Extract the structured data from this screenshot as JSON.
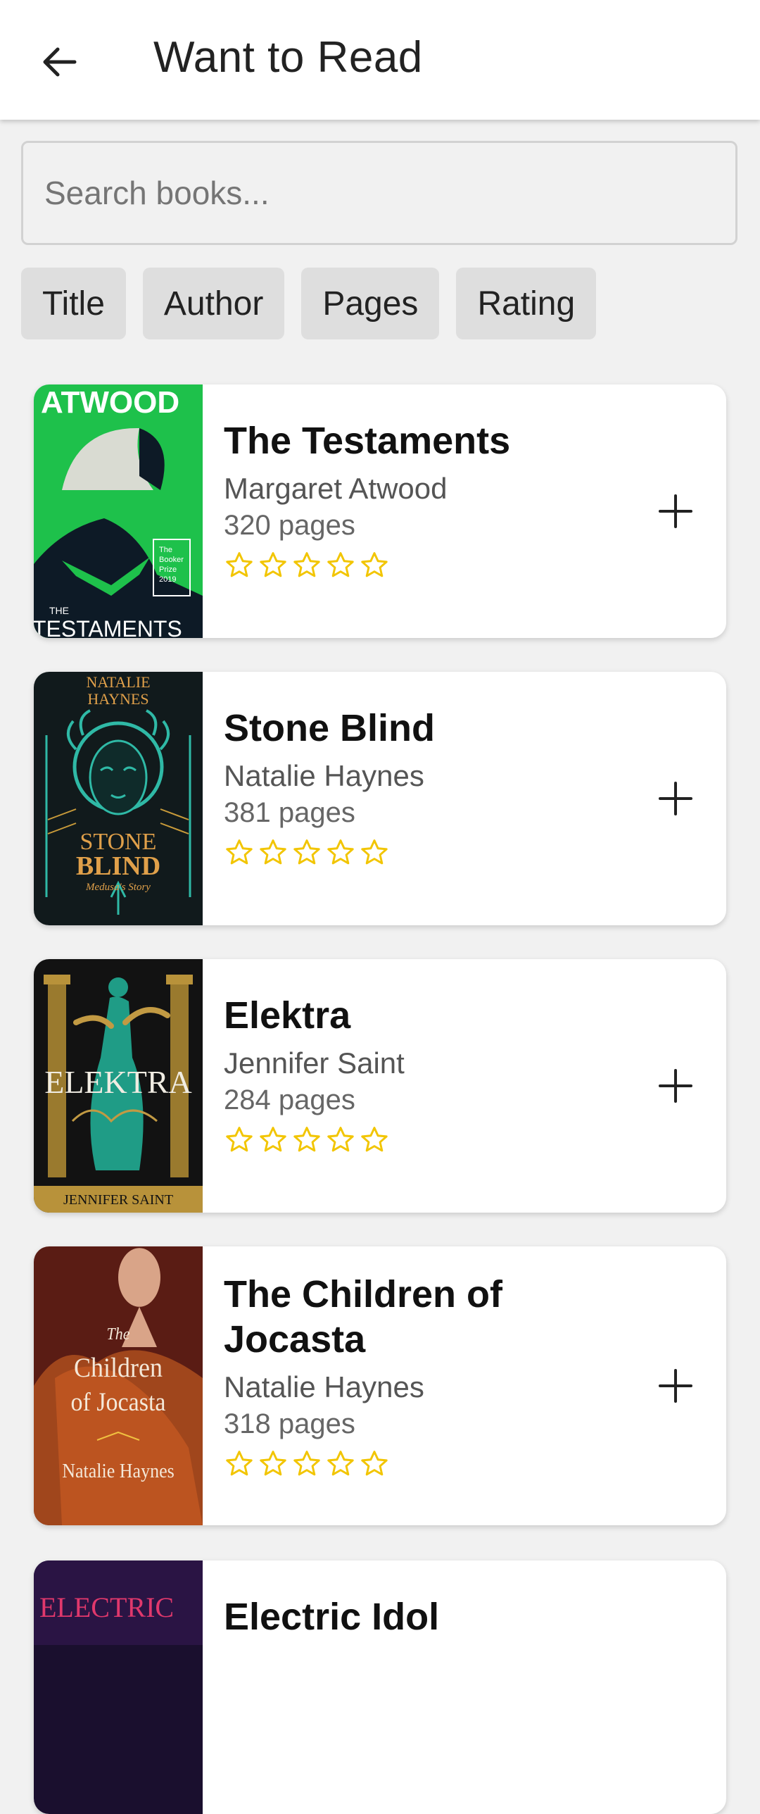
{
  "appbar": {
    "title": "Want to Read",
    "back_icon": "arrow-left-icon"
  },
  "search": {
    "placeholder": "Search books...",
    "value": ""
  },
  "sort_chips": [
    "Title",
    "Author",
    "Pages",
    "Rating"
  ],
  "colors": {
    "star": "#f2c500",
    "accent": "#222222"
  },
  "books": [
    {
      "title": "The Testaments",
      "author": "Margaret Atwood",
      "pages": "320 pages",
      "rating": 0,
      "cover_text": [
        "ATWOOD",
        "THE",
        "TESTAMENTS"
      ],
      "cover_badge": [
        "The",
        "Booker",
        "Prize",
        "2019"
      ]
    },
    {
      "title": "Stone Blind",
      "author": "Natalie Haynes",
      "pages": "381 pages",
      "rating": 0,
      "cover_text": [
        "NATALIE",
        "HAYNES",
        "STONE",
        "BLIND",
        "Medusa's Story"
      ]
    },
    {
      "title": "Elektra",
      "author": "Jennifer Saint",
      "pages": "284 pages",
      "rating": 0,
      "cover_text": [
        "ELEKTRA",
        "JENNIFER SAINT"
      ]
    },
    {
      "title": "The Children of Jocasta",
      "author": "Natalie Haynes",
      "pages": "318 pages",
      "rating": 0,
      "cover_text": [
        "The",
        "Children",
        "of Jocasta",
        "Natalie Haynes"
      ]
    },
    {
      "title": "Electric Idol",
      "author": "",
      "pages": "",
      "rating": 0,
      "cover_text": [
        "ELECTRIC"
      ]
    }
  ]
}
